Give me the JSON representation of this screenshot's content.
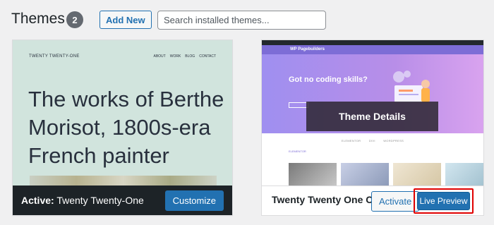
{
  "header": {
    "title": "Themes",
    "count": "2",
    "add_new_label": "Add New",
    "search_placeholder": "Search installed themes..."
  },
  "active_theme": {
    "preview": {
      "site_title": "TWENTY TWENTY-ONE",
      "menu": [
        "ABOUT",
        "WORK",
        "BLOG",
        "CONTACT"
      ],
      "headline": "The works of Berthe Morisot, 1800s-era French painter"
    },
    "active_prefix": "Active:",
    "name": "Twenty Twenty-One",
    "customize_label": "Customize"
  },
  "child_theme": {
    "preview": {
      "logo": "WP Pagebuilders",
      "hero_title": "Got no coding skills?",
      "tabs": [
        "ELEMENTOR",
        "DIVI",
        "WORDPRESS"
      ],
      "section_label": "ELEMENTOR"
    },
    "overlay_label": "Theme Details",
    "name": "Twenty Twenty One Child",
    "activate_label": "Activate",
    "live_preview_label": "Live Preview",
    "highlight_color": "#e00000"
  },
  "colors": {
    "primary": "#2271b1",
    "active_bar": "#1d2327",
    "active_preview_bg": "#d1e4dd",
    "hero_gradient_start": "#9f8ff0",
    "hero_gradient_end": "#d9a3ef"
  }
}
